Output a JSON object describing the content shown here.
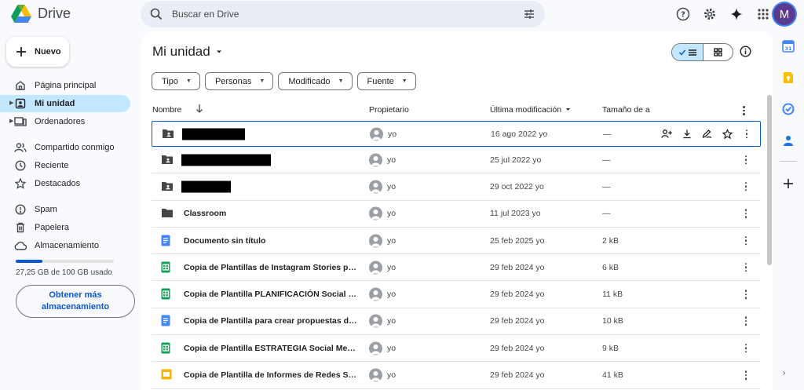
{
  "app": {
    "name": "Drive"
  },
  "search": {
    "placeholder": "Buscar en Drive"
  },
  "user": {
    "avatar_letter": "M"
  },
  "new_button": {
    "label": "Nuevo"
  },
  "nav": {
    "items": [
      {
        "label": "Página principal",
        "icon": "home-icon"
      },
      {
        "label": "Mi unidad",
        "icon": "my-drive-icon",
        "active": true
      },
      {
        "label": "Ordenadores",
        "icon": "computers-icon"
      },
      {
        "label": "Compartido conmigo",
        "icon": "shared-icon"
      },
      {
        "label": "Reciente",
        "icon": "clock-icon"
      },
      {
        "label": "Destacados",
        "icon": "star-icon"
      },
      {
        "label": "Spam",
        "icon": "spam-icon"
      },
      {
        "label": "Papelera",
        "icon": "trash-icon"
      },
      {
        "label": "Almacenamiento",
        "icon": "cloud-icon"
      }
    ]
  },
  "storage": {
    "text": "27,25 GB de 100 GB usado",
    "used_fraction": 0.2725,
    "cta": "Obtener más almacenamiento"
  },
  "main": {
    "title": "Mi unidad"
  },
  "filters": [
    "Tipo",
    "Personas",
    "Modificado",
    "Fuente"
  ],
  "columns": {
    "name": "Nombre",
    "owner": "Propietario",
    "modified": "Última modificación",
    "size": "Tamaño de a"
  },
  "files": [
    {
      "type": "shared-folder",
      "name": "",
      "redacted": true,
      "owner": "yo",
      "modified": "16 ago 2022 yo",
      "size": "—"
    },
    {
      "type": "shared-folder",
      "name": "",
      "redacted": true,
      "owner": "yo",
      "modified": "25 jul 2022 yo",
      "size": "—"
    },
    {
      "type": "shared-folder",
      "name": "",
      "redacted": true,
      "owner": "yo",
      "modified": "29 oct 2022 yo",
      "size": "—"
    },
    {
      "type": "folder",
      "name": "Classroom",
      "owner": "yo",
      "modified": "11 jul 2023 yo",
      "size": "—"
    },
    {
      "type": "doc",
      "name": "Documento sin título",
      "owner": "yo",
      "modified": "25 feb 2025 yo",
      "size": "2 kB"
    },
    {
      "type": "sheet",
      "name": "Copia de Plantillas de Instagram Stories para ...",
      "owner": "yo",
      "modified": "29 feb 2024 yo",
      "size": "6 kB"
    },
    {
      "type": "sheet",
      "name": "Copia de Plantilla PLANIFICACIÓN Social Med...",
      "owner": "yo",
      "modified": "29 feb 2024 yo",
      "size": "11 kB"
    },
    {
      "type": "doc",
      "name": "Copia de Plantilla para crear propuestas de re...",
      "owner": "yo",
      "modified": "29 feb 2024 yo",
      "size": "10 kB"
    },
    {
      "type": "sheet",
      "name": "Copia de Plantilla ESTRATEGIA Social Media ...",
      "owner": "yo",
      "modified": "29 feb 2024 yo",
      "size": "9 kB"
    },
    {
      "type": "slides",
      "name": "Copia de Plantilla de Informes de Redes Socia...",
      "owner": "yo",
      "modified": "29 feb 2024 yo",
      "size": "41 kB"
    }
  ],
  "colors": {
    "accent": "#0b57d0",
    "active_bg": "#c2e7ff",
    "doc": "#4285f4",
    "sheet": "#0f9d58",
    "slides": "#f4b400"
  }
}
